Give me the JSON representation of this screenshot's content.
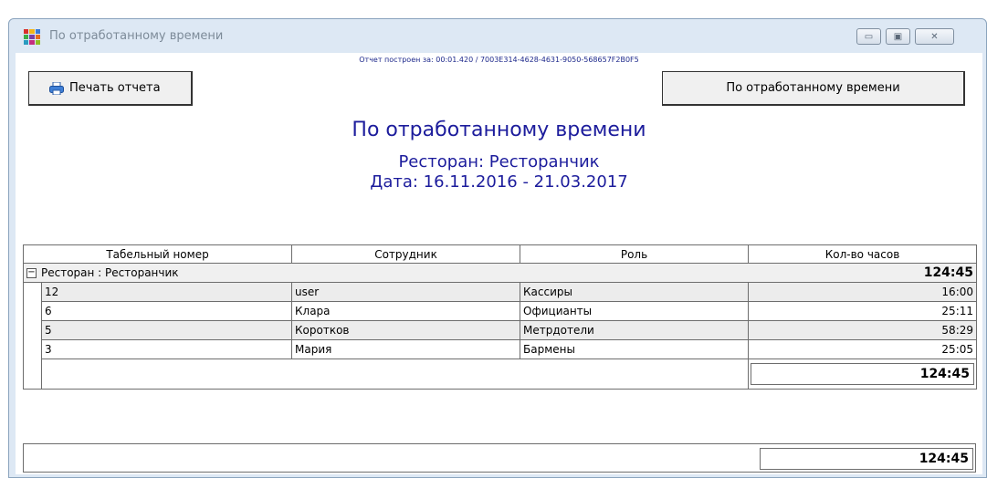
{
  "window": {
    "title": "По отработанному времени",
    "controls": {
      "minimize": "▭",
      "maximize": "▣",
      "close": "✕"
    }
  },
  "report": {
    "info": "Отчет построен за: 00:01.420 / 7003E314-4628-4631-9050-568657F2B0F5",
    "print_button": "Печать отчета",
    "report_button": "По отработанному времени",
    "heading": "По отработанному времени",
    "restaurant": "Ресторан: Ресторанчик",
    "date": "Дата: 16.11.2016 - 21.03.2017"
  },
  "table": {
    "columns": [
      "Табельный номер",
      "Сотрудник",
      "Роль",
      "Кол-во часов"
    ],
    "group": {
      "label": "Ресторан : Ресторанчик",
      "total": "124:45",
      "expander": "−"
    },
    "rows": [
      {
        "id": "12",
        "employee": "user",
        "role": "Кассиры",
        "hours": "16:00"
      },
      {
        "id": "6",
        "employee": "Клара",
        "role": "Официанты",
        "hours": "25:11"
      },
      {
        "id": "5",
        "employee": "Коротков",
        "role": "Метрдотели",
        "hours": "58:29"
      },
      {
        "id": "3",
        "employee": "Мария",
        "role": "Бармены",
        "hours": "25:05"
      }
    ],
    "group_subtotal": "124:45",
    "grand_total": "124:45"
  },
  "colors": {
    "title_blue": "#1c1c9c",
    "window_frame": "#dde8f4"
  }
}
